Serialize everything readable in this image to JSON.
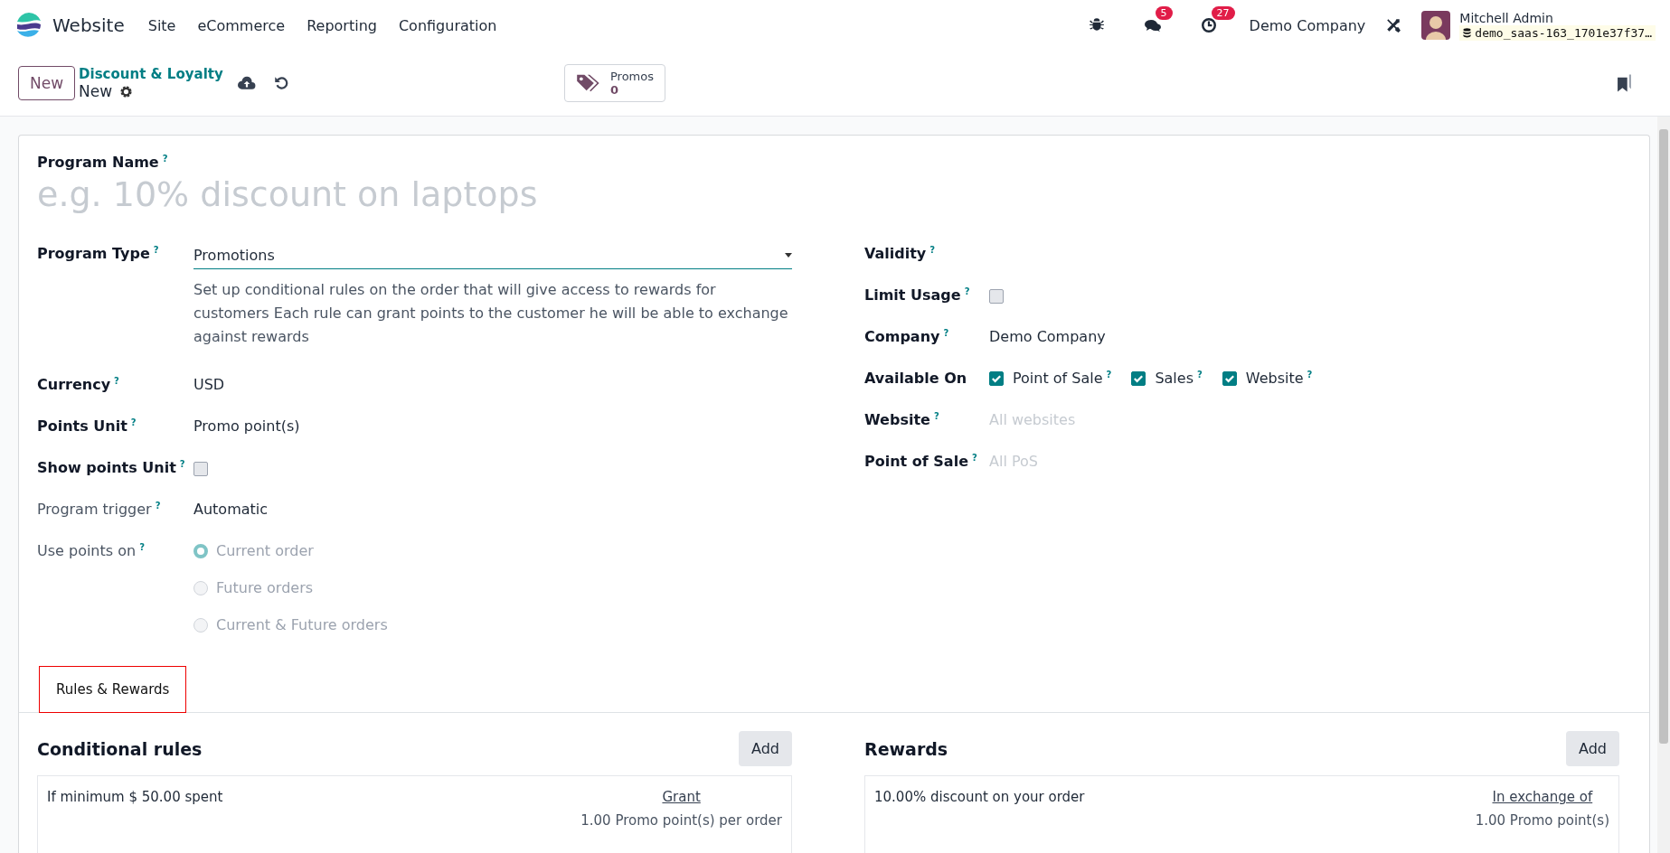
{
  "navbar": {
    "app_name": "Website",
    "menu": [
      "Site",
      "eCommerce",
      "Reporting",
      "Configuration"
    ],
    "messages_badge": "5",
    "activities_badge": "27",
    "company": "Demo Company",
    "user": "Mitchell Admin",
    "database": "demo_saas-163_1701e37f37…"
  },
  "control_panel": {
    "new_button": "New",
    "breadcrumb": "Discount & Loyalty",
    "record": "New",
    "smart_button": {
      "label": "Promos",
      "count": "0"
    }
  },
  "form": {
    "name_label": "Program Name",
    "name_help": "?",
    "name_placeholder": "e.g. 10% discount on laptops",
    "left_fields": [
      {
        "kind": "select",
        "label": "Program Type",
        "help": "?",
        "muted": false,
        "value": "Promotions",
        "description": "Set up conditional rules on the order that will give access to rewards for customers Each rule can grant points to the customer he will be able to exchange against rewards"
      },
      {
        "kind": "text",
        "label": "Currency",
        "help": "?",
        "muted": false,
        "value": "USD"
      },
      {
        "kind": "text",
        "label": "Points Unit",
        "help": "?",
        "muted": false,
        "value": "Promo point(s)"
      },
      {
        "kind": "checkbox",
        "label": "Show points Unit",
        "help": "?",
        "muted": false,
        "checked": false
      },
      {
        "kind": "text",
        "label": "Program trigger",
        "help": "?",
        "muted": true,
        "value": "Automatic"
      },
      {
        "kind": "radio",
        "label": "Use points on",
        "help": "?",
        "muted": true,
        "options": [
          {
            "label": "Current order",
            "selected": true
          },
          {
            "label": "Future orders",
            "selected": false
          },
          {
            "label": "Current & Future orders",
            "selected": false
          }
        ]
      }
    ],
    "right_fields": [
      {
        "kind": "empty",
        "label": "Validity",
        "help": "?"
      },
      {
        "kind": "checkbox",
        "label": "Limit Usage",
        "help": "?",
        "checked": false
      },
      {
        "kind": "text",
        "label": "Company",
        "help": "?",
        "value": "Demo Company"
      },
      {
        "kind": "checks",
        "label": "Available On",
        "options": [
          {
            "label": "Point of Sale",
            "help": "?",
            "checked": true
          },
          {
            "label": "Sales",
            "help": "?",
            "checked": true
          },
          {
            "label": "Website",
            "help": "?",
            "checked": true
          }
        ]
      },
      {
        "kind": "placeholder",
        "label": "Website",
        "help": "?",
        "placeholder": "All websites"
      },
      {
        "kind": "placeholder",
        "label": "Point of Sale",
        "help": "?",
        "placeholder": "All PoS"
      }
    ],
    "tabs": [
      {
        "label": "Rules & Rewards",
        "selected": true
      }
    ],
    "panels": [
      {
        "title": "Conditional rules",
        "add_button": "Add",
        "row": {
          "description": "If minimum $ 50.00 spent",
          "link": "Grant",
          "detail": "1.00 Promo point(s) per order"
        }
      },
      {
        "title": "Rewards",
        "add_button": "Add",
        "row": {
          "description": "10.00% discount on your order",
          "link": "In exchange of",
          "detail": "1.00 Promo point(s)"
        }
      }
    ]
  }
}
